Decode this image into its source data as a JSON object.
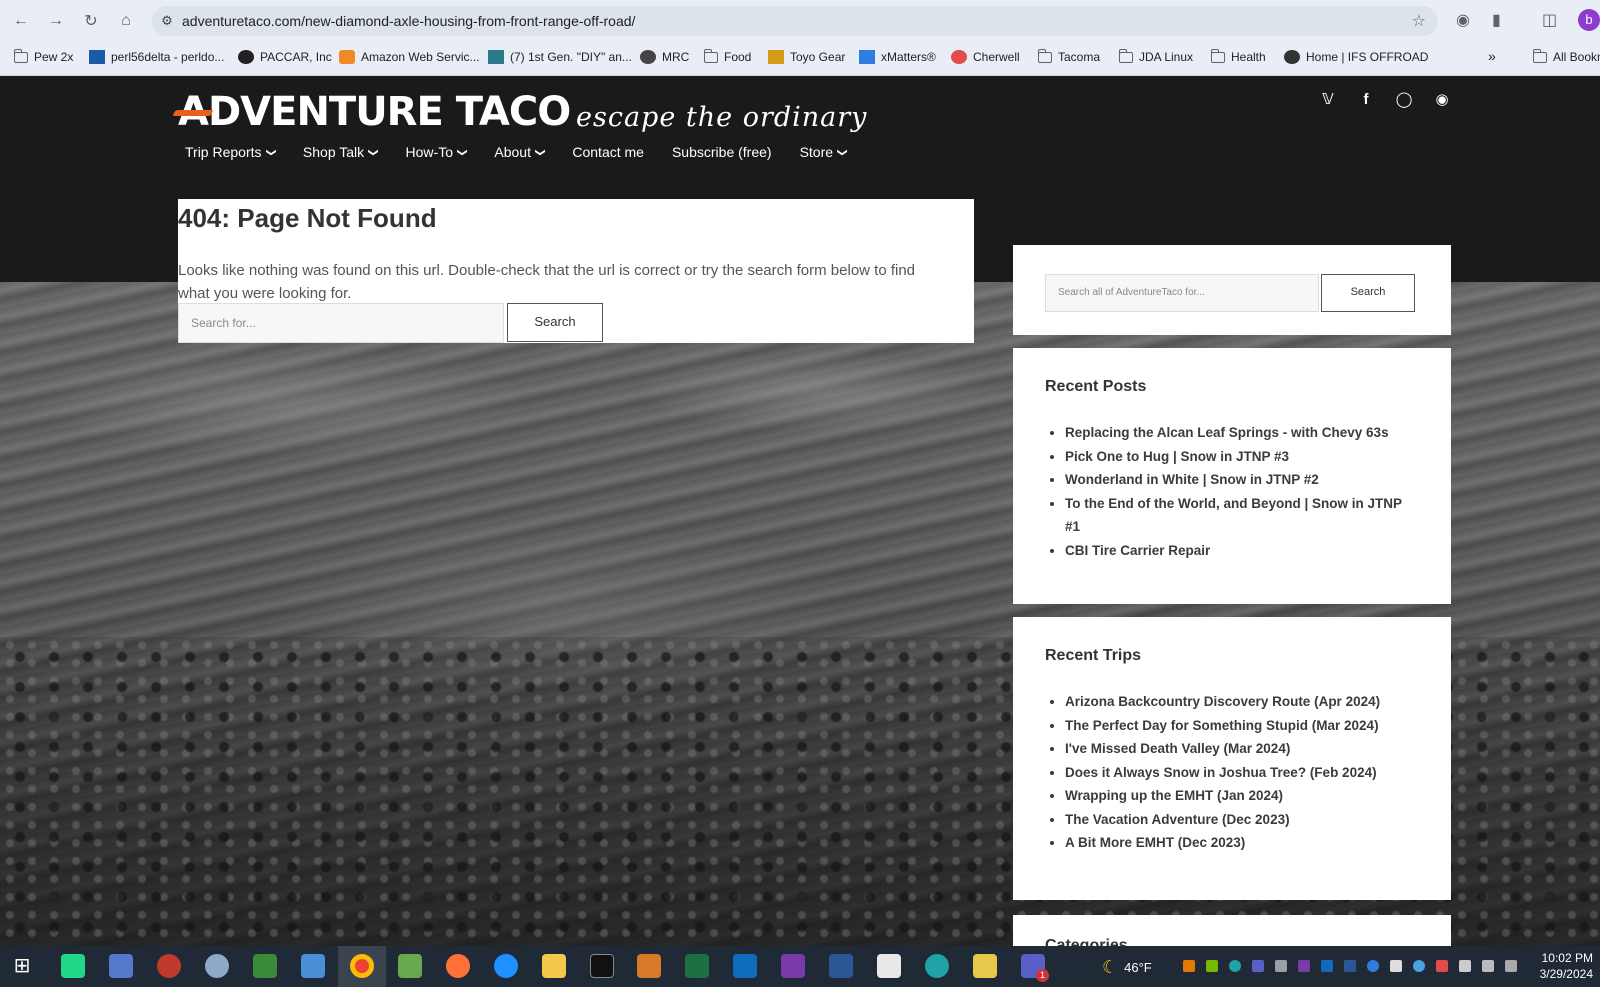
{
  "browser": {
    "url": "adventuretaco.com/new-diamond-axle-housing-from-front-range-off-road/",
    "profile_initial": "b",
    "bookmarks": [
      {
        "label": "Pew 2x",
        "icon": "folder-icon"
      },
      {
        "label": "perl56delta - perldo...",
        "icon": "perl-icon"
      },
      {
        "label": "PACCAR, Inc",
        "icon": "github-icon"
      },
      {
        "label": "Amazon Web Servic...",
        "icon": "aws-icon"
      },
      {
        "label": "(7) 1st Gen. \"DIY\" an...",
        "icon": "forum-icon"
      },
      {
        "label": "MRC",
        "icon": "globe-icon"
      },
      {
        "label": "Food",
        "icon": "folder-icon"
      },
      {
        "label": "Toyo Gear",
        "icon": "toyo-icon"
      },
      {
        "label": "xMatters®",
        "icon": "xmatters-icon"
      },
      {
        "label": "Cherwell",
        "icon": "cherwell-icon"
      },
      {
        "label": "Tacoma",
        "icon": "folder-icon"
      },
      {
        "label": "JDA Linux",
        "icon": "folder-icon"
      },
      {
        "label": "Health",
        "icon": "folder-icon"
      },
      {
        "label": "Home | IFS OFFROAD",
        "icon": "ifs-icon"
      }
    ],
    "more_bookmarks": "»",
    "all_bookmarks": "All Bookmarks"
  },
  "site": {
    "brand": "ADVENTURE TACO",
    "tagline": "escape the ordinary",
    "social": [
      "twitter-icon",
      "facebook-icon",
      "instagram-icon",
      "patreon-icon"
    ],
    "nav": [
      {
        "label": "Trip Reports",
        "dropdown": true
      },
      {
        "label": "Shop Talk",
        "dropdown": true
      },
      {
        "label": "How-To",
        "dropdown": true
      },
      {
        "label": "About",
        "dropdown": true
      },
      {
        "label": "Contact me",
        "dropdown": false
      },
      {
        "label": "Subscribe (free)",
        "dropdown": false
      },
      {
        "label": "Store",
        "dropdown": true
      }
    ]
  },
  "notfound": {
    "title": "404: Page Not Found",
    "message": "Looks like nothing was found on this url. Double-check that the url is correct or try the search form below to find what you were looking for.",
    "search_placeholder": "Search for...",
    "search_button": "Search"
  },
  "sidebar": {
    "search_placeholder": "Search all of AdventureTaco for...",
    "search_button": "Search",
    "recent_posts": {
      "title": "Recent Posts",
      "items": [
        "Replacing the Alcan Leaf Springs - with Chevy 63s",
        "Pick One to Hug | Snow in JTNP #3",
        "Wonderland in White | Snow in JTNP #2",
        "To the End of the World, and Beyond | Snow in JTNP #1",
        "CBI Tire Carrier Repair"
      ]
    },
    "recent_trips": {
      "title": "Recent Trips",
      "items": [
        "Arizona Backcountry Discovery Route (Apr 2024)",
        "The Perfect Day for Something Stupid (Mar 2024)",
        "I've Missed Death Valley (Mar 2024)",
        "Does it Always Snow in Joshua Tree? (Feb 2024)",
        "Wrapping up the EMHT (Jan 2024)",
        "The Vacation Adventure (Dec 2023)",
        "A Bit More EMHT (Dec 2023)"
      ]
    },
    "categories_title": "Categories"
  },
  "taskbar": {
    "weather_temp": "46°F",
    "time": "10:02 PM",
    "date": "3/29/2024",
    "notification_badge": "1"
  }
}
